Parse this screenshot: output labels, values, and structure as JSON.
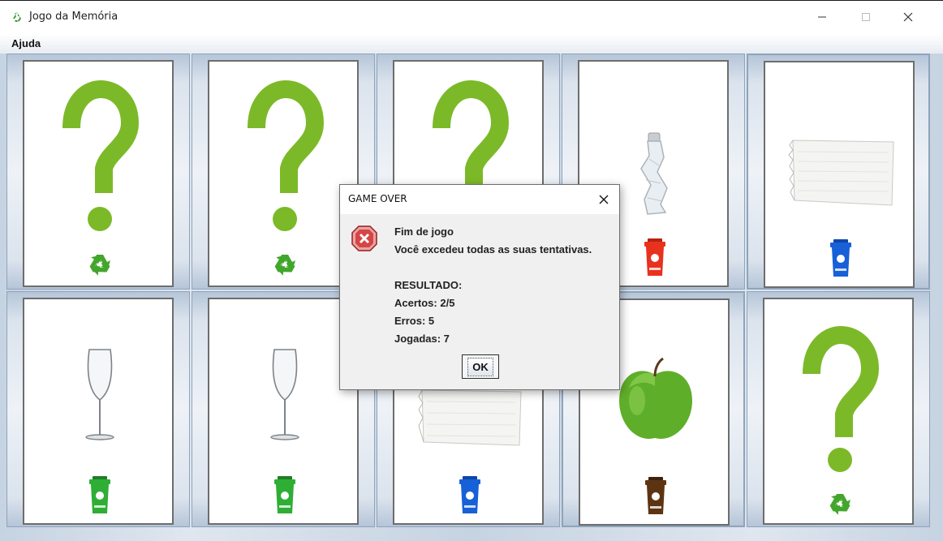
{
  "window": {
    "title": "Jogo da Memória",
    "icon": "recycle-icon",
    "controls": [
      "minimize-icon",
      "maximize-icon",
      "close-icon"
    ]
  },
  "menu": {
    "items": [
      "Ajuda"
    ]
  },
  "board": {
    "rows": 2,
    "cols": 5,
    "cards": [
      {
        "state": "hidden",
        "content": "question-mark",
        "icon": "recycle-icon"
      },
      {
        "state": "hidden",
        "content": "question-mark",
        "icon": "recycle-icon"
      },
      {
        "state": "hidden",
        "content": "question-mark",
        "icon": "recycle-icon"
      },
      {
        "state": "revealed",
        "content": "plastic-bottle",
        "icon": "red-bin-icon",
        "bin_label": "Plástico"
      },
      {
        "state": "revealed",
        "content": "paper-sheet",
        "icon": "blue-bin-icon",
        "bin_label": "Papel"
      },
      {
        "state": "revealed",
        "content": "wine-glass",
        "icon": "green-bin-icon",
        "bin_label": "Vidro"
      },
      {
        "state": "revealed",
        "content": "wine-glass",
        "icon": "green-bin-icon",
        "bin_label": "Vidro"
      },
      {
        "state": "revealed",
        "content": "paper-sheet",
        "icon": "blue-bin-icon",
        "bin_label": "Papel"
      },
      {
        "state": "revealed",
        "content": "green-apple",
        "icon": "brown-bin-icon",
        "bin_label": "Orgânico"
      },
      {
        "state": "hidden",
        "content": "question-mark",
        "icon": "recycle-icon"
      }
    ],
    "colors": {
      "question": "#7cb928",
      "bin_red": "#e8321e",
      "bin_blue": "#1760d8",
      "bin_green": "#2fae35",
      "bin_brown": "#5d3412"
    }
  },
  "dialog": {
    "title": "GAME OVER",
    "icon": "error-icon",
    "lines": [
      "Fim de jogo",
      "Você excedeu todas as suas tentativas.",
      "",
      "RESULTADO:",
      "Acertos: 2/5",
      "Erros: 5",
      "Jogadas: 7"
    ],
    "ok_label": "OK"
  }
}
